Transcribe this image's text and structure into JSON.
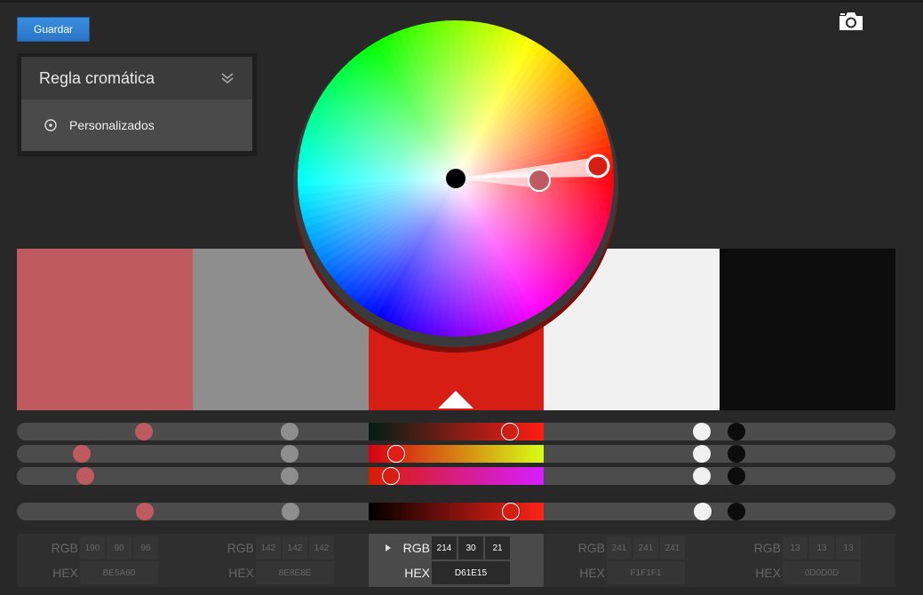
{
  "toolbar": {
    "save_label": "Guardar"
  },
  "rule_panel": {
    "title": "Regla cromática",
    "option": "Personalizados"
  },
  "swatches": [
    {
      "color": "#BE5A60"
    },
    {
      "color": "#8E8E8E"
    },
    {
      "color": "#D61E15"
    },
    {
      "color": "#F1F1F1"
    },
    {
      "color": "#0D0D0D"
    }
  ],
  "values": [
    {
      "rgb_label": "RGB",
      "hex_label": "HEX",
      "r": "190",
      "g": "90",
      "b": "96",
      "hex": "BE5A60"
    },
    {
      "rgb_label": "RGB",
      "hex_label": "HEX",
      "r": "142",
      "g": "142",
      "b": "142",
      "hex": "8E8E8E"
    },
    {
      "rgb_label": "RGB",
      "hex_label": "HEX",
      "r": "214",
      "g": "30",
      "b": "21",
      "hex": "D61E15"
    },
    {
      "rgb_label": "RGB",
      "hex_label": "HEX",
      "r": "241",
      "g": "241",
      "b": "241",
      "hex": "F1F1F1"
    },
    {
      "rgb_label": "RGB",
      "hex_label": "HEX",
      "r": "13",
      "g": "13",
      "b": "13",
      "hex": "0D0D0D"
    }
  ],
  "active_swatch_index": 2,
  "icons": {
    "camera": "camera-icon",
    "chevron": "double-chevron-down-icon",
    "radio": "radio-target-icon"
  }
}
